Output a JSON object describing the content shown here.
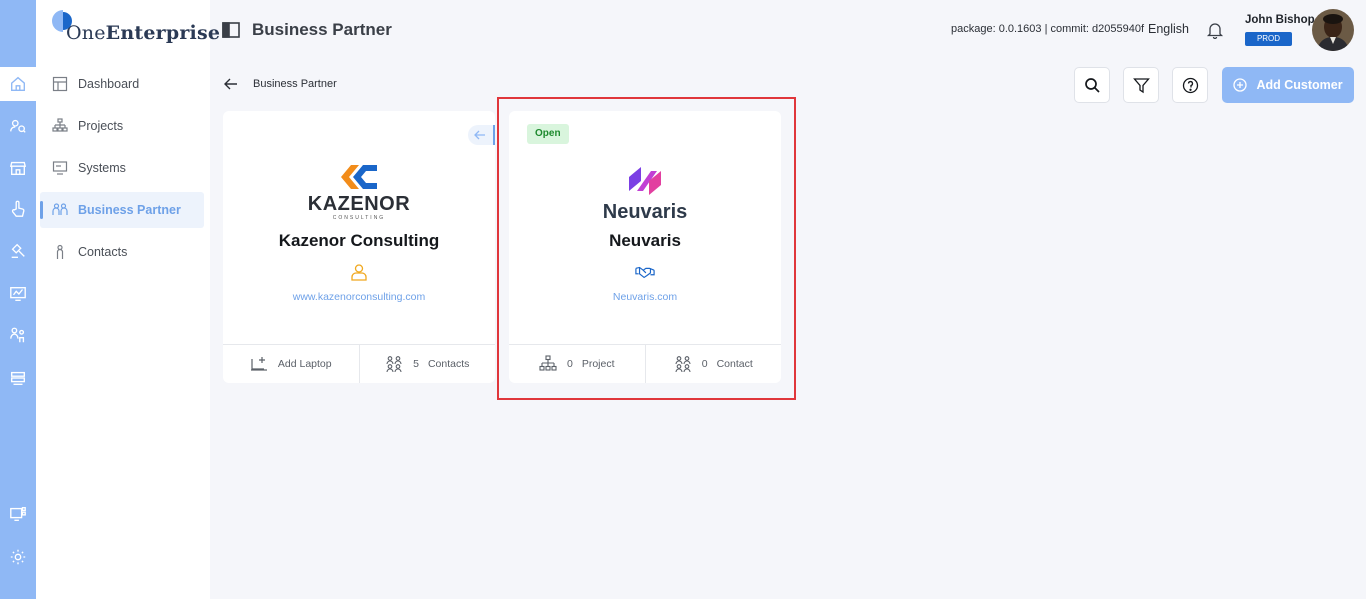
{
  "app": {
    "brand_part1": "One",
    "brand_part2": "Enterprise"
  },
  "rail": {
    "icons": [
      "home-icon",
      "people-search-icon",
      "store-icon",
      "hand-pointer-icon",
      "hammer-icon",
      "monitor-chart-icon",
      "team-icon",
      "layers-icon",
      "monitor-grid-icon",
      "gear-icon"
    ],
    "active_index": 0
  },
  "sidebar": {
    "items": [
      {
        "label": "Dashboard",
        "icon": "dashboard-icon"
      },
      {
        "label": "Projects",
        "icon": "hierarchy-icon"
      },
      {
        "label": "Systems",
        "icon": "systems-icon"
      },
      {
        "label": "Business Partner",
        "icon": "partners-icon",
        "active": true
      },
      {
        "label": "Contacts",
        "icon": "person-icon"
      }
    ]
  },
  "header": {
    "title": "Business Partner",
    "package_info": "package: 0.0.1603 | commit: d2055940f",
    "language": "English",
    "user_name": "John Bishop",
    "env_badge": "PROD"
  },
  "toolbar": {
    "breadcrumb": "Business Partner",
    "add_label": "Add Customer",
    "buttons": [
      "search-icon",
      "filter-icon",
      "help-icon"
    ]
  },
  "cards": [
    {
      "logo_text": "KAZENOR",
      "logo_subtext": "CONSULTING",
      "name": "Kazenor Consulting",
      "type_icon": "person-badge-icon",
      "link": "www.kazenorconsulting.com",
      "footer": {
        "left_label": "Add Laptop",
        "right_count": "5",
        "right_label": "Contacts"
      },
      "accent": "#f0a81e"
    },
    {
      "status": "Open",
      "logo_text": "Neuvaris",
      "name": "Neuvaris",
      "type_icon": "handshake-icon",
      "link": "Neuvaris.com",
      "footer": {
        "left_count": "0",
        "left_label": "Project",
        "right_count": "0",
        "right_label": "Contact"
      },
      "accent": "#1a66c9"
    }
  ],
  "colors": {
    "rail": "#8fb8f5",
    "accent": "#6ea1e8",
    "prod_badge": "#1a66c9",
    "highlight": "#e0363b"
  }
}
